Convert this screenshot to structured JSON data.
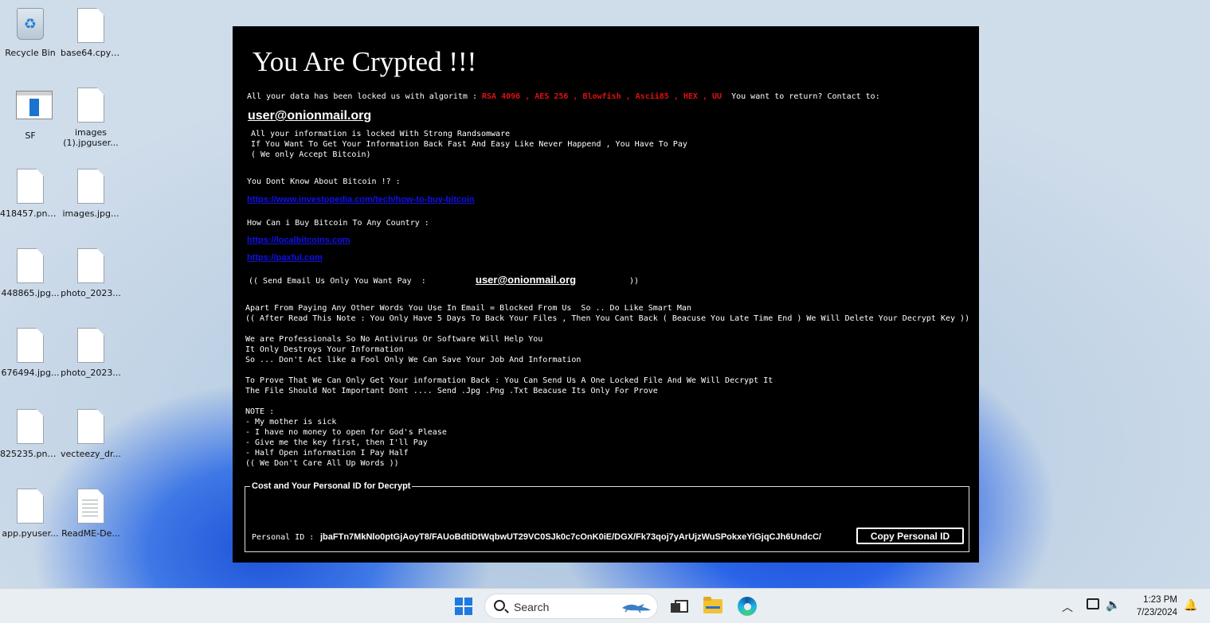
{
  "desktop": {
    "icons": [
      {
        "label": "Recycle Bin",
        "type": "recycle-bin"
      },
      {
        "label": "base64.cpyt...",
        "type": "file"
      },
      {
        "label": "SF",
        "type": "app"
      },
      {
        "label": "images (1).jpguser...",
        "type": "file"
      },
      {
        "label": "418457.png...",
        "type": "file"
      },
      {
        "label": "images.jpg...",
        "type": "file"
      },
      {
        "label": "448865.jpg...",
        "type": "file"
      },
      {
        "label": "photo_2023...",
        "type": "file"
      },
      {
        "label": "676494.jpg...",
        "type": "file"
      },
      {
        "label": "photo_2023...",
        "type": "file"
      },
      {
        "label": "825235.png...",
        "type": "file"
      },
      {
        "label": "vecteezy_dr...",
        "type": "file"
      },
      {
        "label": "app.pyuser...",
        "type": "file"
      },
      {
        "label": "ReadME-De...",
        "type": "document"
      }
    ]
  },
  "note": {
    "title": "You Are Crypted !!!",
    "intro_prefix": "All your data has been locked us with algoritm : ",
    "algorithms": "RSA 4096 , AES 256 , Blowfish , Ascii85 , HEX , UU",
    "intro_suffix": "  You want to return? Contact to:",
    "email": "user@onionmail.org",
    "locked_text": "All your information is locked With Strong Randsomware\nIf You Want To Get Your Information Back Fast And Easy Like Never Happend , You Have To Pay\n( We only Accept Bitcoin)",
    "bitcoin_question": "You Dont Know About Bitcoin !? :",
    "link_investopedia": "https://www.investopedia.com/tech/how-to-buy-bitcoin",
    "country_question": "How Can i Buy Bitcoin To Any Country :",
    "link_localbitcoins": "https://localbitcoins.com",
    "link_paxful": "https://paxful.com",
    "send_email_text": "(( Send Email Us Only You Want Pay  :",
    "send_email_close": "))",
    "body_text": "Apart From Paying Any Other Words You Use In Email = Blocked From Us  So .. Do Like Smart Man\n(( After Read This Note : You Only Have 5 Days To Back Your Files , Then You Cant Back ( Beacuse You Late Time End ) We Will Delete Your Decrypt Key ))\n\nWe are Professionals So No Antivirus Or Software Will Help You\nIt Only Destroys Your Information\nSo ... Don't Act like a Fool Only We Can Save Your Job And Information\n\nTo Prove That We Can Only Get Your information Back : You Can Send Us A One Locked File And We Will Decrypt It\nThe File Should Not Important Dont .... Send .Jpg .Png .Txt Beacuse Its Only For Prove\n\nNOTE :\n- My mother is sick\n- I have no money to open for God's Please\n- Give me the key first, then I'll Pay\n- Half Open information I Pay Half\n(( We Don't Care All Up Words ))",
    "cost_legend": "Cost and Your Personal ID for Decrypt",
    "personal_id_label": "Personal ID :",
    "personal_id_value": "jbaFTn7MkNlo0ptGjAoyT8/FAUoBdtiDtWqbwUT29VC0SJk0c7cOnK0iE/DGX/Fk73qoj7yArUjzWuSPokxeYiGjqCJh6UndcC/",
    "copy_button": "Copy Personal ID",
    "colors": {
      "background": "#000000",
      "algorithms": "#e01010",
      "links": "#1010e8"
    }
  },
  "taskbar": {
    "search_placeholder": "Search",
    "time": "1:23 PM",
    "date": "7/23/2024"
  }
}
